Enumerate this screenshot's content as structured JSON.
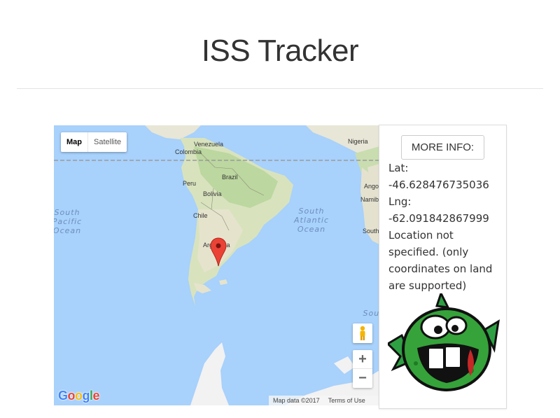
{
  "header": {
    "title": "ISS Tracker"
  },
  "map": {
    "type_controls": {
      "map_label": "Map",
      "satellite_label": "Satellite",
      "selected": "Map"
    },
    "labels": {
      "venezuela": "Venezuela",
      "colombia": "Colombia",
      "nigeria": "Nigeria",
      "brazil": "Brazil",
      "peru": "Peru",
      "bolivia": "Bolivia",
      "chile": "Chile",
      "argentina": "Argentina",
      "angola": "Ango",
      "namibia": "Namib",
      "south_africa": "South"
    },
    "oceans": {
      "south_pacific": "South\nPacific\nOcean",
      "south_atlantic": "South\nAtlantic\nOcean",
      "southern": "Sout"
    },
    "zoom_in": "+",
    "zoom_out": "−",
    "logo": "Google",
    "attribution": {
      "data": "Map data ©2017",
      "terms": "Terms of Use"
    },
    "marker_icon": "map-pin-icon",
    "pegman_icon": "street-view-pegman-icon"
  },
  "info": {
    "button_label": "MORE INFO:",
    "lat_label": "Lat:",
    "lat_value": "-46.628476735036",
    "lng_label": "Lng:",
    "lng_value": "-62.091842867999",
    "location_text": "Location not specified. (only coordinates on land are supported)",
    "mascot_icon": "green-fish-mascot-icon"
  },
  "colors": {
    "ocean": "#a8d1fb",
    "land": "#e8e6d6",
    "forest": "#c9ddb0",
    "marker": "#ea4335"
  }
}
